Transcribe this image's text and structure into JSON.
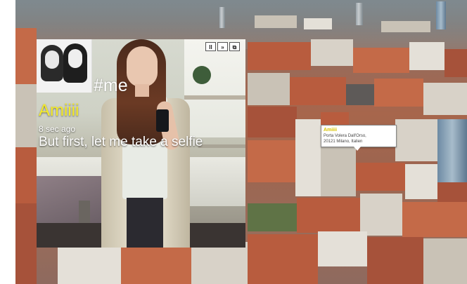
{
  "post": {
    "hashtag": "#me",
    "username": "Amiiii",
    "time": "8 sec ago",
    "caption": "But first, let me take a selfie"
  },
  "controls": {
    "pause_glyph": "II",
    "skip_glyph": "»",
    "external_glyph": "⧉"
  },
  "pin_tooltip": {
    "name": "Amiiii",
    "address_line1": "Porta Volera Dall'Orso,",
    "address_line2": "20121 Milano, Italien"
  },
  "colors": {
    "username": "#f4ea2a",
    "caption": "#ffffff",
    "tooltip_name": "#d8c400"
  },
  "icons": [
    "pause-icon",
    "skip-icon",
    "open-external-icon",
    "map-pin-tooltip"
  ]
}
